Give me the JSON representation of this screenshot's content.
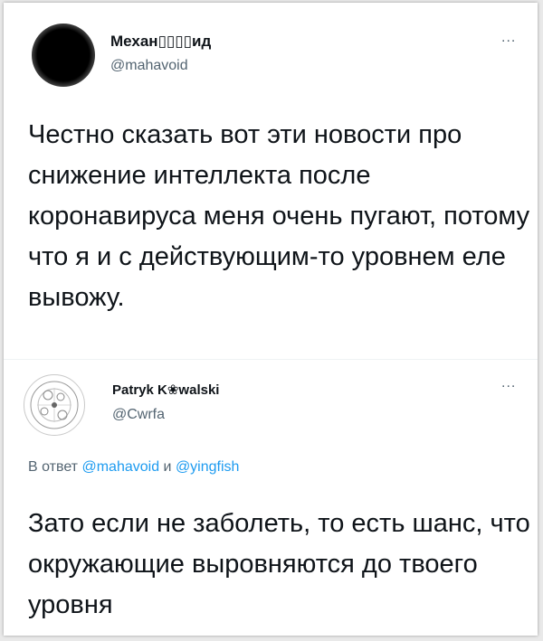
{
  "tweets": [
    {
      "name": "Механ▯▯▯▯ид",
      "handle": "@mahavoid",
      "more": "...",
      "text": "Честно сказать вот эти новости про снижение интеллекта после коронавируса меня очень пугают, потому что я и с действующим-то уровнем еле вывожу."
    },
    {
      "name": "Patryk K❀walski",
      "handle": "@Cwrfa",
      "more": "...",
      "reply_prefix": "В ответ",
      "reply_user1": "@mahavoid",
      "reply_and": "и",
      "reply_user2": "@yingfish",
      "text": "Зато если не заболеть, то есть шанс, что окружающие выровняются до твоего уровня"
    }
  ],
  "colors": {
    "link": "#1d9bf0",
    "secondary": "#536471",
    "text": "#0f1419"
  },
  "icons": {
    "avatar1": "black-circle-avatar",
    "avatar2": "sketch-circle-avatar"
  }
}
